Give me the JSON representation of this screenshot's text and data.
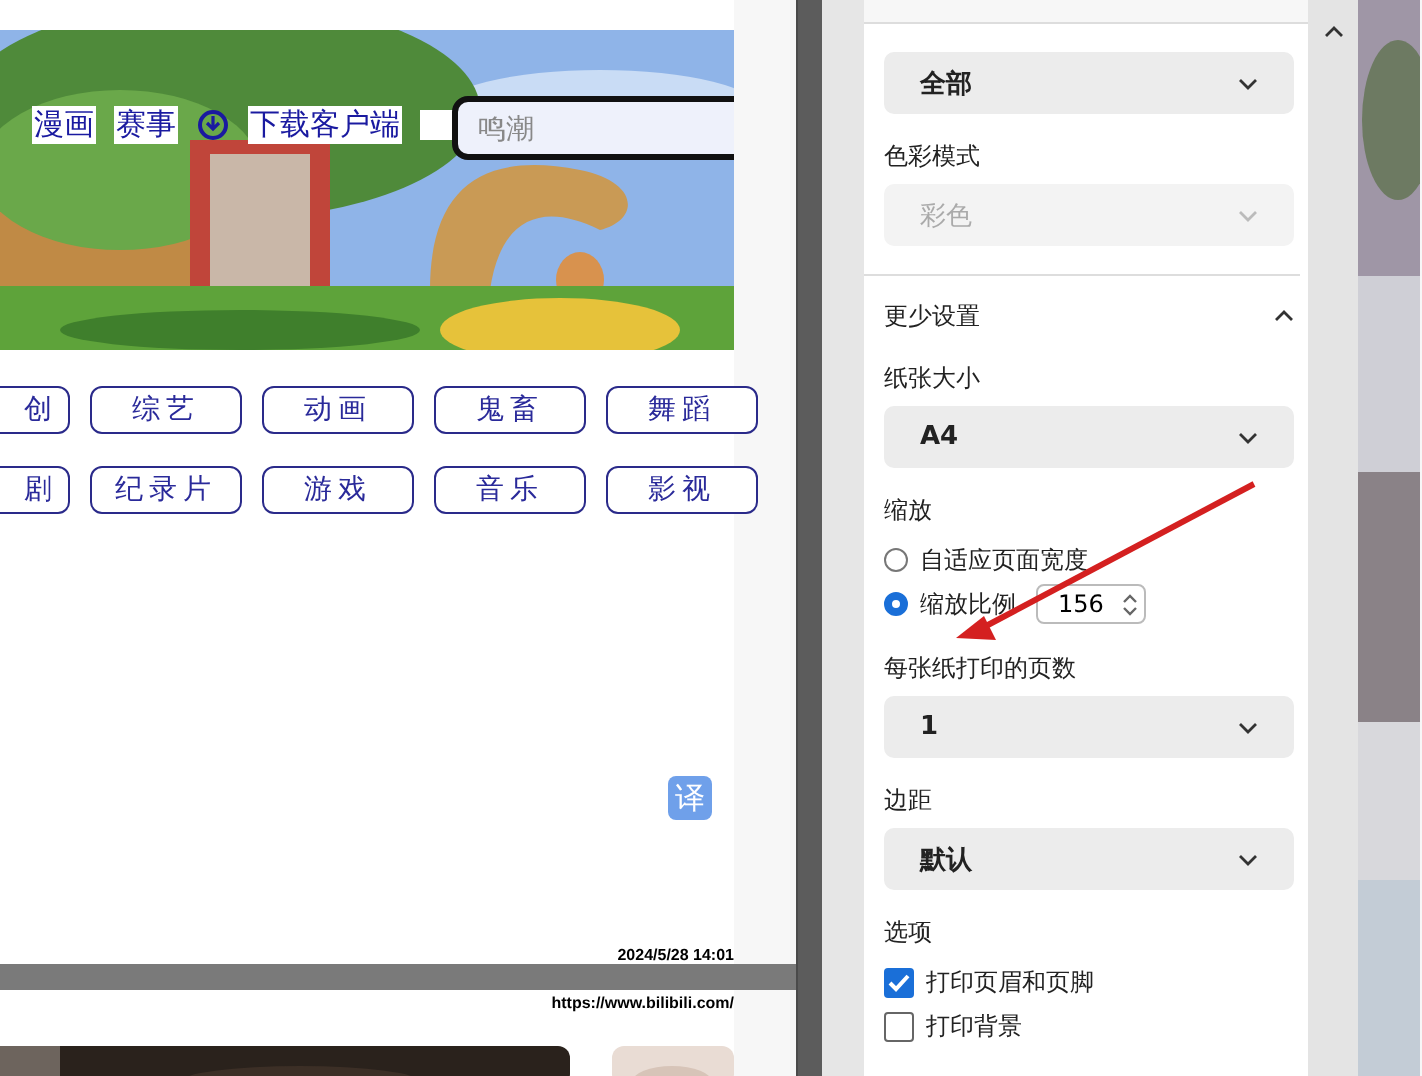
{
  "preview": {
    "nav_links": [
      {
        "kind": "link",
        "label": "漫画"
      },
      {
        "kind": "link",
        "label": "赛事"
      },
      {
        "kind": "download",
        "label": "下载客户端"
      }
    ],
    "search": {
      "placeholder": "鸣潮"
    },
    "category_rows": [
      [
        "创",
        "综艺",
        "动画",
        "鬼畜",
        "舞蹈"
      ],
      [
        "剧",
        "纪录片",
        "游戏",
        "音乐",
        "影视"
      ]
    ],
    "translate_badge": "译",
    "timestamp": "2024/5/28 14:01",
    "next_page_url": "https://www.bilibili.com/"
  },
  "settings": [
    {
      "kind": "select",
      "value": "全部",
      "disabled": false
    },
    {
      "kind": "label",
      "text": "色彩模式"
    },
    {
      "kind": "select",
      "value": "彩色",
      "disabled": true
    },
    {
      "kind": "section",
      "text": "更少设置",
      "expanded": true
    },
    {
      "kind": "label",
      "text": "纸张大小"
    },
    {
      "kind": "select",
      "value": "A4",
      "disabled": false
    },
    {
      "kind": "label",
      "text": "缩放"
    },
    {
      "kind": "radio",
      "text": "自适应页面宽度",
      "selected": false
    },
    {
      "kind": "radio",
      "text": "缩放比例",
      "selected": true,
      "value": "156"
    },
    {
      "kind": "label",
      "text": "每张纸打印的页数"
    },
    {
      "kind": "select",
      "value": "1",
      "disabled": false
    },
    {
      "kind": "label",
      "text": "边距"
    },
    {
      "kind": "select",
      "value": "默认",
      "disabled": false
    },
    {
      "kind": "label",
      "text": "选项"
    },
    {
      "kind": "checkbox",
      "text": "打印页眉和页脚",
      "checked": true
    },
    {
      "kind": "checkbox",
      "text": "打印背景",
      "checked": false
    }
  ]
}
